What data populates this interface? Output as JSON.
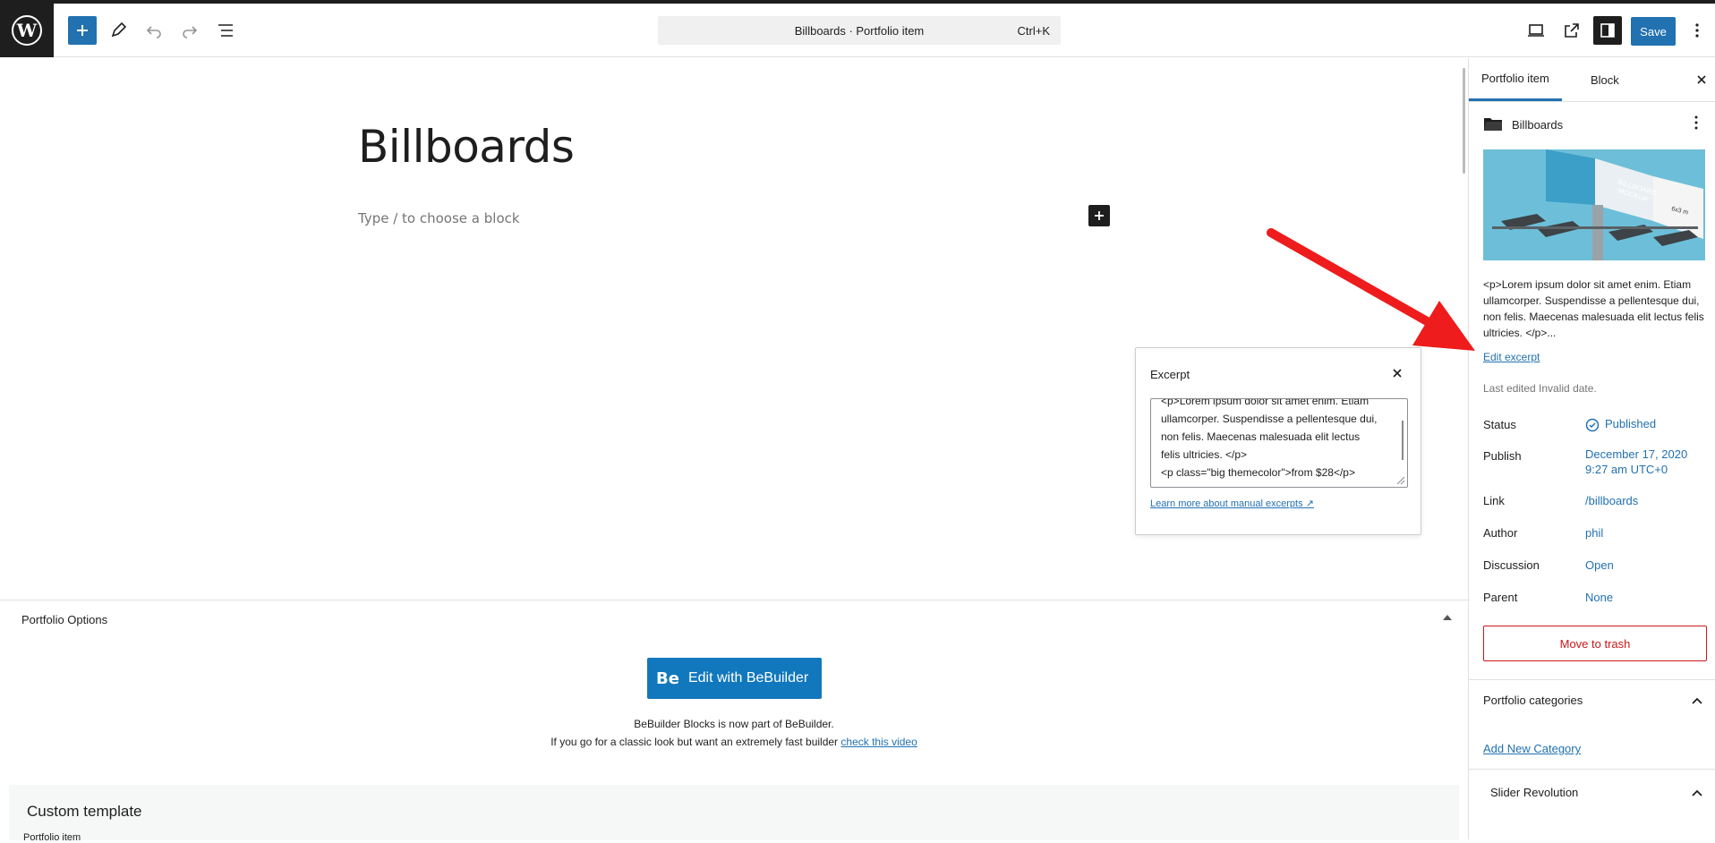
{
  "toolbar": {
    "document_title": "Billboards · Portfolio item",
    "shortcut": "Ctrl+K",
    "save_label": "Save"
  },
  "editor": {
    "post_title": "Billboards",
    "block_placeholder": "Type / to choose a block"
  },
  "excerpt_popover": {
    "title": "Excerpt",
    "text_lines": [
      "<p>Lorem ipsum dolor sit amet enim. Etiam",
      "ullamcorper. Suspendisse a pellentesque dui,",
      "non felis. Maecenas malesuada elit lectus",
      "felis ultricies. </p>",
      "<p class=\"big themecolor\">from $28</p>"
    ],
    "learn_more": "Learn more about manual excerpts ↗"
  },
  "meta_box": {
    "title": "Portfolio Options",
    "bebuilder_label": "Edit with BeBuilder",
    "bebuilder_logo": "Be",
    "note_line1": "BeBuilder Blocks is now part of BeBuilder.",
    "note_line2": "If you go for a classic look but want an extremely fast builder",
    "note_link": "check this video",
    "custom_template": "Custom template",
    "cut_label": "Portfolio item"
  },
  "sidebar": {
    "tabs": [
      "Portfolio item",
      "Block"
    ],
    "card_title": "Billboards",
    "featured_image_text": [
      "BILLBOARD",
      "MOCKUP",
      "6x3 m"
    ],
    "excerpt": "<p>Lorem ipsum dolor sit amet enim. Etiam ullamcorper. Suspendisse a pellentesque dui, non felis. Maecenas malesuada elit lectus felis ultricies. </p>...",
    "edit_excerpt": "Edit excerpt",
    "last_edited": "Last edited Invalid date.",
    "rows": [
      {
        "label": "Status",
        "value": "Published"
      },
      {
        "label": "Publish",
        "value": "December 17, 2020 9:27 am UTC+0"
      },
      {
        "label": "Link",
        "value": "/billboards"
      },
      {
        "label": "Author",
        "value": "phil"
      },
      {
        "label": "Discussion",
        "value": "Open"
      },
      {
        "label": "Parent",
        "value": "None"
      }
    ],
    "trash": "Move to trash",
    "portfolio_categories": "Portfolio categories",
    "add_category": "Add New Category",
    "slider_revolution": "Slider Revolution"
  },
  "colors": {
    "accent": "#2271b1",
    "danger": "#cc1818",
    "annotation_arrow": "#ee1c1c"
  }
}
